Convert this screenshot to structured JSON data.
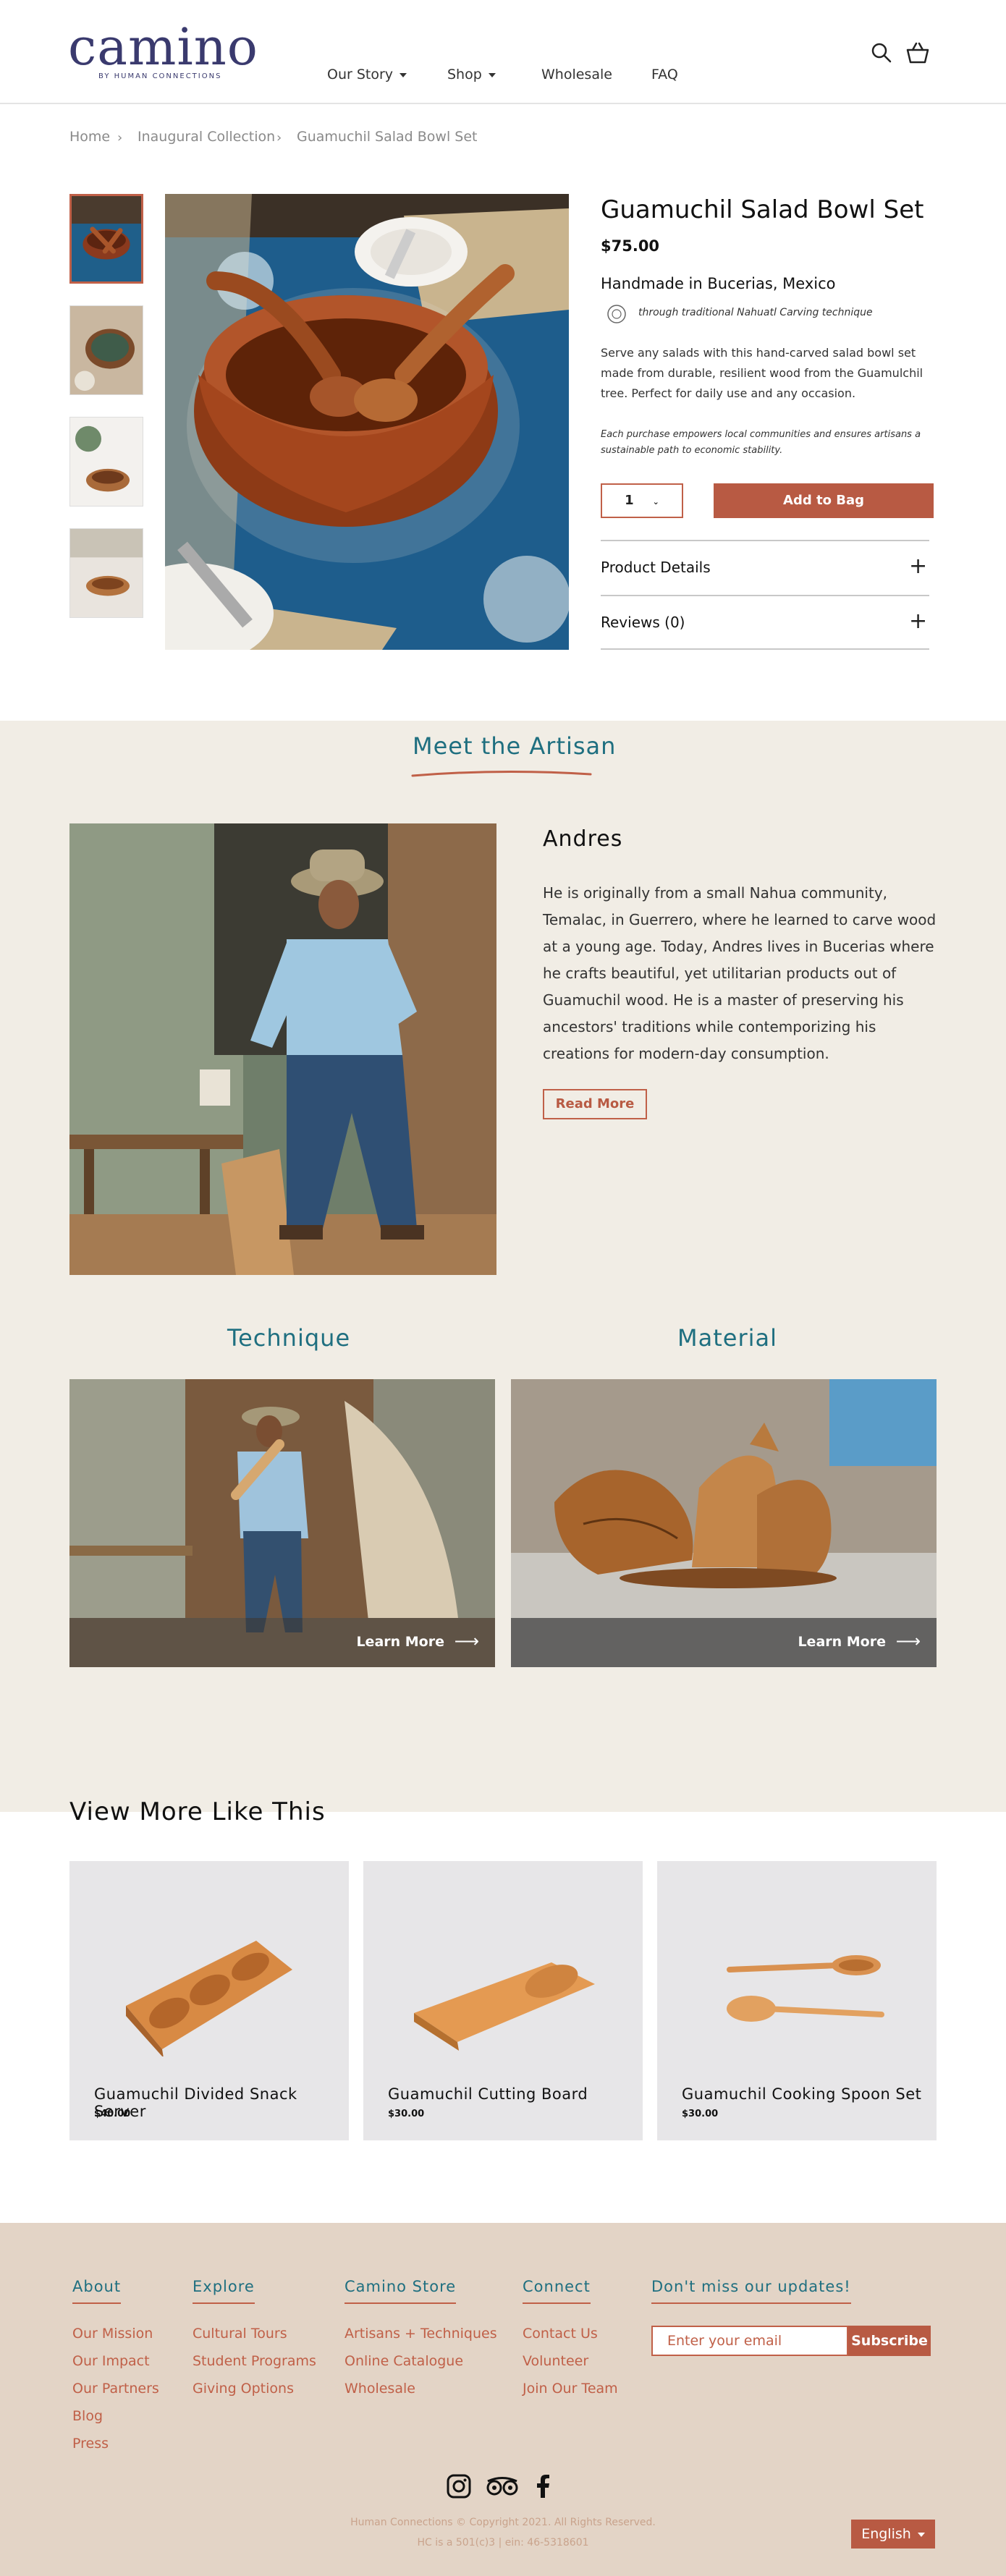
{
  "header": {
    "logo": "camino",
    "logo_sub": "BY HUMAN CONNECTIONS",
    "nav": [
      "Our Story",
      "Shop",
      "Wholesale",
      "FAQ"
    ],
    "icons": [
      "search-icon",
      "shopping-bag-icon"
    ]
  },
  "breadcrumb": [
    "Home",
    "Inaugural Collection",
    "Guamuchil Salad Bowl Set"
  ],
  "product": {
    "title": "Guamuchil Salad Bowl Set",
    "price": "$75.00",
    "made_in": "Handmade in Bucerias, Mexico",
    "technique": "through traditional Nahuatl Carving technique",
    "description": "Serve any salads with this hand-carved salad bowl set made from durable, resilient wood from the Guamulchil tree. Perfect for daily use and any occasion.",
    "note": "Each purchase empowers local communities and ensures artisans a sustainable path to economic stability.",
    "quantity": "1",
    "add_to_bag": "Add to Bag",
    "accordions": [
      "Product Details",
      "Reviews (0)"
    ]
  },
  "artisan": {
    "section_title": "Meet the Artisan",
    "name": "Andres",
    "bio": "He is originally from a small Nahua community, Temalac, in Guerrero, where he learned to carve wood at a young age. Today, Andres lives in Bucerias where he crafts beautiful, yet utilitarian products out of Guamuchil wood. He is a master of preserving his ancestors' traditions while contemporizing his creations for modern-day consumption.",
    "read_more": "Read More"
  },
  "cards": [
    {
      "title": "Technique",
      "link": "Learn More"
    },
    {
      "title": "Material",
      "link": "Learn More"
    }
  ],
  "more": {
    "title": "View More Like This",
    "items": [
      {
        "name": "Guamuchil Divided Snack Server",
        "price": "$40.00"
      },
      {
        "name": "Guamuchil Cutting Board",
        "price": "$30.00"
      },
      {
        "name": "Guamuchil Cooking Spoon Set",
        "price": "$30.00"
      }
    ]
  },
  "footer": {
    "about": {
      "title": "About",
      "links": [
        "Our Mission",
        "Our Impact",
        "Our Partners",
        "Blog",
        "Press"
      ]
    },
    "explore": {
      "title": "Explore",
      "links": [
        "Cultural Tours",
        "Student Programs",
        "Giving Options"
      ]
    },
    "store": {
      "title": "Camino Store",
      "links": [
        "Artisans + Techniques",
        "Online Catalogue",
        "Wholesale"
      ]
    },
    "connect": {
      "title": "Connect",
      "links": [
        "Contact Us",
        "Volunteer",
        "Join Our Team"
      ]
    },
    "newsletter": {
      "title": "Don't miss our updates!",
      "placeholder": "Enter your email",
      "button": "Subscribe"
    },
    "social": [
      "instagram-icon",
      "tripadvisor-icon",
      "facebook-icon"
    ],
    "copyright": "Human Connections  © Copyright 2021. All Rights Reserved.",
    "ein": "HC is a 501(c)3 | ein: 46-5318601",
    "language": "English"
  },
  "colors": {
    "accent": "#b85a43",
    "teal": "#1f6f80",
    "artisan_bg": "#f1ede5",
    "footer_bg": "#e3d4c6"
  }
}
